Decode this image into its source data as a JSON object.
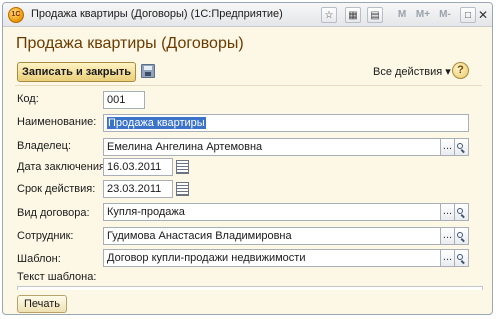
{
  "window": {
    "title": "Продажа квартиры (Договоры)  (1С:Предприятие)",
    "logo_text": "1С",
    "toolbar_calc": [
      "M",
      "M+",
      "M-"
    ]
  },
  "form": {
    "title": "Продажа квартиры (Договоры)",
    "save_close_label": "Записать и закрыть",
    "all_actions_label": "Все действия ▾",
    "help_label": "?"
  },
  "fields": {
    "code": {
      "label": "Код:",
      "value": "001"
    },
    "name": {
      "label": "Наименование:",
      "value": "Продажа квартиры"
    },
    "owner": {
      "label": "Владелец:",
      "value": "Емелина Ангелина Артемовна"
    },
    "date_concluded": {
      "label": "Дата заключения:",
      "value": "16.03.2011"
    },
    "valid_until": {
      "label": "Срок действия:",
      "value": "23.03.2011"
    },
    "contract_type": {
      "label": "Вид договора:",
      "value": "Купля-продажа"
    },
    "employee": {
      "label": "Сотрудник:",
      "value": "Гудимова Анастасия Владимировна"
    },
    "template": {
      "label": "Шаблон:",
      "value": "Договор купли-продажи недвижимости"
    },
    "template_text": {
      "label": "Текст шаблона:",
      "value": ""
    }
  },
  "select_button_label": "...",
  "print_label": "Печать"
}
